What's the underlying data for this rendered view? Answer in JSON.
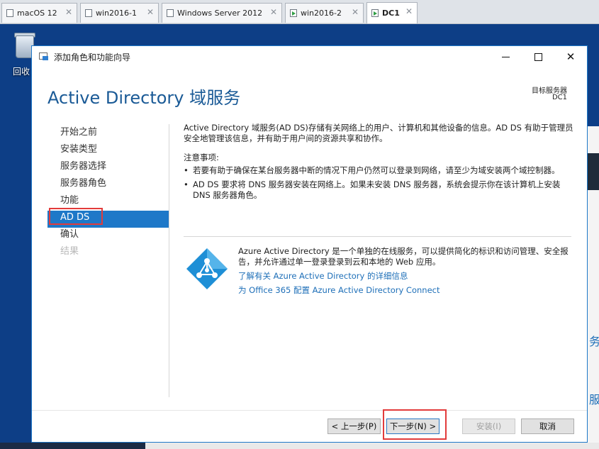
{
  "vm_tabs": [
    {
      "label": "macOS 12",
      "active": false,
      "running": false
    },
    {
      "label": "win2016-1",
      "active": false,
      "running": false
    },
    {
      "label": "Windows Server 2012",
      "active": false,
      "running": false
    },
    {
      "label": "win2016-2",
      "active": false,
      "running": true
    },
    {
      "label": "DC1",
      "active": true,
      "running": true
    }
  ],
  "desktop": {
    "recycle_bin_label": "回收",
    "background_window_chars": [
      "务",
      "服"
    ]
  },
  "window": {
    "title": "添加角色和功能向导",
    "page_title": "Active Directory 域服务",
    "destination_label": "目标服务器",
    "destination_value": "DC1"
  },
  "nav": {
    "items": [
      {
        "label": "开始之前",
        "state": "normal"
      },
      {
        "label": "安装类型",
        "state": "normal"
      },
      {
        "label": "服务器选择",
        "state": "normal"
      },
      {
        "label": "服务器角色",
        "state": "normal"
      },
      {
        "label": "功能",
        "state": "normal"
      },
      {
        "label": "AD DS",
        "state": "active"
      },
      {
        "label": "确认",
        "state": "normal"
      },
      {
        "label": "结果",
        "state": "disabled"
      }
    ]
  },
  "content": {
    "intro": "Active Directory 域服务(AD DS)存储有关网络上的用户、计算机和其他设备的信息。AD DS 有助于管理员安全地管理该信息，并有助于用户间的资源共享和协作。",
    "notes_title": "注意事项:",
    "notes": [
      "若要有助于确保在某台服务器中断的情况下用户仍然可以登录到网络，请至少为域安装两个域控制器。",
      "AD DS 要求将 DNS 服务器安装在网络上。如果未安装 DNS 服务器，系统会提示你在该计算机上安装 DNS 服务器角色。"
    ],
    "azure_text": "Azure Active Directory 是一个单独的在线服务，可以提供简化的标识和访问管理、安全报告，并允许通过单一登录登录到云和本地的 Web 应用。",
    "links": [
      "了解有关 Azure Active Directory 的详细信息",
      "为 Office 365 配置 Azure Active Directory Connect"
    ]
  },
  "buttons": {
    "prev": "< 上一步(P)",
    "next": "下一步(N) >",
    "install": "安装(I)",
    "cancel": "取消"
  },
  "colors": {
    "accent": "#1e78c8",
    "title_blue": "#1a5a96",
    "link": "#1e6fb8",
    "highlight": "#e23b3b"
  }
}
